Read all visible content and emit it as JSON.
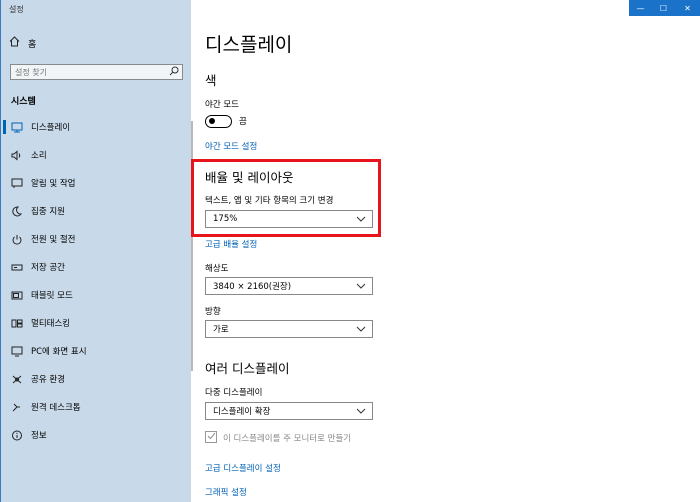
{
  "window": {
    "title": "설정"
  },
  "sidebar": {
    "home_label": "홈",
    "search_placeholder": "설정 찾기",
    "section_label": "시스템",
    "items": [
      {
        "label": "디스플레이",
        "icon": "monitor-icon"
      },
      {
        "label": "소리",
        "icon": "speaker-icon"
      },
      {
        "label": "알림 및 작업",
        "icon": "notification-icon"
      },
      {
        "label": "집중 지원",
        "icon": "moon-icon"
      },
      {
        "label": "전원 및 절전",
        "icon": "power-icon"
      },
      {
        "label": "저장 공간",
        "icon": "storage-icon"
      },
      {
        "label": "태블릿 모드",
        "icon": "tablet-icon"
      },
      {
        "label": "멀티태스킹",
        "icon": "multitask-icon"
      },
      {
        "label": "PC에 화면 표시",
        "icon": "project-icon"
      },
      {
        "label": "공유 환경",
        "icon": "shared-icon"
      },
      {
        "label": "원격 데스크톱",
        "icon": "remote-icon"
      },
      {
        "label": "정보",
        "icon": "info-icon"
      }
    ]
  },
  "main": {
    "title": "디스플레이",
    "color_header": "색",
    "night_light_label": "야간 모드",
    "night_light_state": "끔",
    "night_light_settings_link": "야간 모드 설정",
    "scale_header": "배율 및 레이아웃",
    "scale_label": "텍스트, 앱 및 기타 항목의 크기 변경",
    "scale_value": "175%",
    "advanced_scaling_link": "고급 배율 설정",
    "resolution_label": "해상도",
    "resolution_value": "3840 × 2160(권장)",
    "orientation_label": "방향",
    "orientation_value": "가로",
    "multi_header": "여러 디스플레이",
    "multi_label": "다중 디스플레이",
    "multi_value": "디스플레이 확장",
    "main_display_checkbox": "이 디스플레이를 주 모니터로 만들기",
    "advanced_display_link": "고급 디스플레이 설정",
    "graphics_link": "그래픽 설정"
  },
  "colors": {
    "accent": "#0063b1",
    "link": "#0060b8",
    "highlight": "#e8141b",
    "sidebar_bg": "#c8d9e9"
  }
}
